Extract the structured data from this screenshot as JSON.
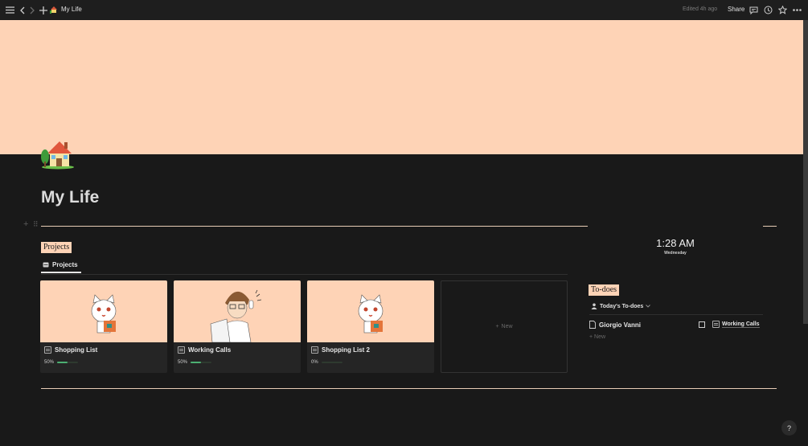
{
  "topbar": {
    "page_title": "My Life",
    "edited": "Edited 4h ago",
    "share": "Share",
    "icons": [
      "menu-icon",
      "back-icon",
      "forward-icon",
      "plus-icon",
      "comment-icon",
      "clock-icon",
      "star-icon",
      "more-icon"
    ]
  },
  "page": {
    "title": "My Life",
    "icon": "house-icon",
    "cover_color": "#fed3b6"
  },
  "projects": {
    "heading": "Projects",
    "view_tab": "Projects",
    "new_label": "New",
    "cards": [
      {
        "title": "Shopping List",
        "progress_label": "50%",
        "progress": 0.5,
        "art": "cat-with-shopping-bag"
      },
      {
        "title": "Working Calls",
        "progress_label": "50%",
        "progress": 0.5,
        "art": "person-on-phone"
      },
      {
        "title": "Shopping List 2",
        "progress_label": "0%",
        "progress": 0.0,
        "art": "cat-with-shopping-bag"
      }
    ]
  },
  "clock": {
    "time": "1:28 AM",
    "weekday": "Wednesday"
  },
  "todoes": {
    "heading": "To-does",
    "view": "Today's To-does",
    "items": [
      {
        "title": "Giorgio Vanni",
        "checked": false,
        "relation": "Working Calls"
      }
    ],
    "new_label": "New"
  },
  "help": "?",
  "colors": {
    "accent": "#fed3b6",
    "background": "#191919",
    "progress": "#4caf72"
  }
}
